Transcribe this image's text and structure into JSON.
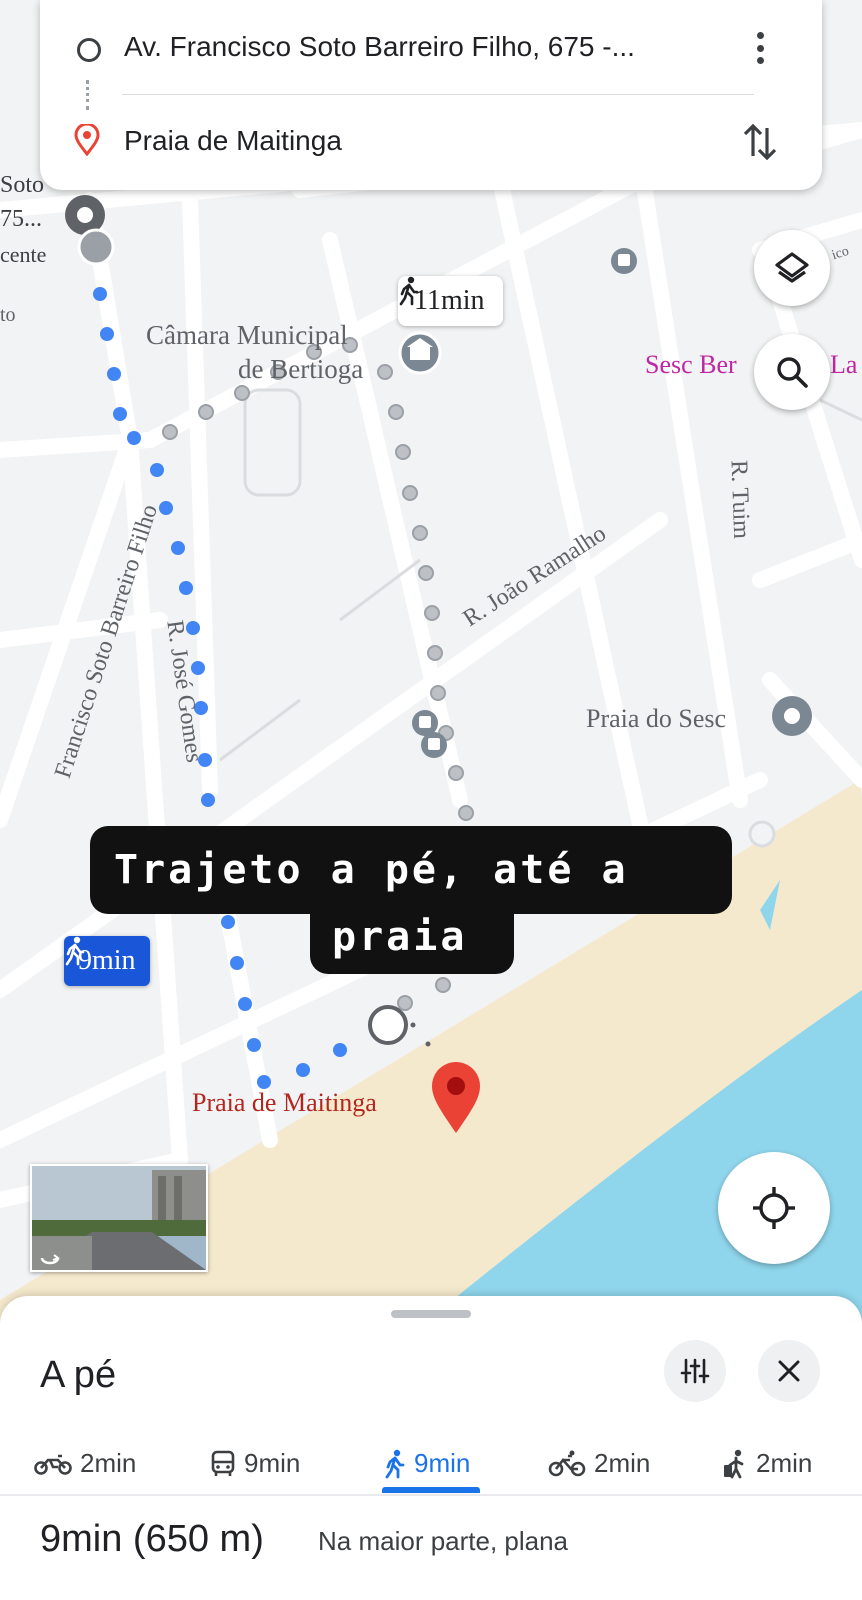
{
  "search_card": {
    "origin": "Av. Francisco Soto Barreiro Filho, 675 -...",
    "destination": "Praia de Maitinga"
  },
  "map": {
    "labels": {
      "soto_fragment": "Soto",
      "num_fragment": "75...",
      "cente_fragment": "cente",
      "to_fragment": "to",
      "camara_line1": "Câmara Municipal",
      "camara_line2": "de Bertioga",
      "sesc_fragment": "Sesc Ber",
      "la_fragment": "La",
      "ico_fragment": "ico",
      "r_tuim": "R. Tuim",
      "joao_ramalho": "R. João Ramalho",
      "jose_gomes": "R. José Gomes",
      "soto_barreiro": "Francisco Soto Barreiro Filho",
      "praia_do_sesc": "Praia do Sesc",
      "praia_de_maitinga": "Praia de Maitinga"
    },
    "alt_route_time": "11min",
    "route_time": "9min"
  },
  "caption": {
    "line1": "Trajeto a pé, até a",
    "line2": "praia"
  },
  "sheet": {
    "title": "A pé",
    "modes": [
      {
        "icon": "motorcycle-icon",
        "label": "2min"
      },
      {
        "icon": "transit-icon",
        "label": "9min"
      },
      {
        "icon": "walk-icon",
        "label": "9min",
        "selected": true
      },
      {
        "icon": "bicycle-icon",
        "label": "2min"
      },
      {
        "icon": "rideshare-icon",
        "label": "2min"
      }
    ],
    "summary_time": "9min (650 m)",
    "summary_note": "Na maior parte, plana"
  },
  "colors": {
    "route_blue": "#4285f4",
    "route_gray": "#bdc1c6",
    "sea": "#8fd6ec",
    "sand": "#f5e9cd",
    "pin_red": "#ea4335",
    "selected_blue": "#1a73e8"
  }
}
